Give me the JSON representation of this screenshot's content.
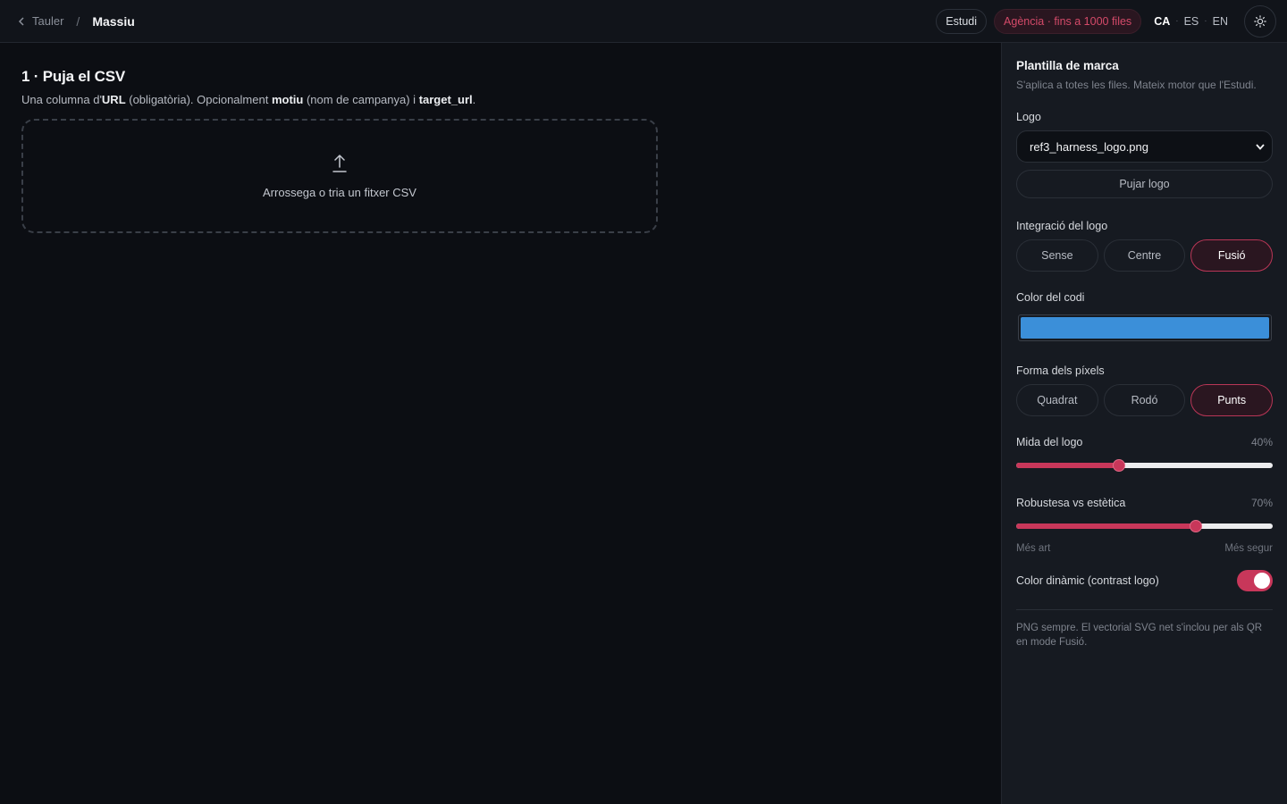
{
  "breadcrumb": {
    "back_label": "Tauler",
    "separator": "/",
    "current": "Massiu"
  },
  "topbar": {
    "studio_label": "Estudi",
    "agency_label": "Agència · fins a 1000 files",
    "languages": [
      {
        "code": "CA",
        "active": true
      },
      {
        "code": "ES",
        "active": false
      },
      {
        "code": "EN",
        "active": false
      }
    ],
    "lang_separator": "·",
    "theme_icon": "sun-icon"
  },
  "main": {
    "step_title": "1 · Puja el CSV",
    "desc_1": "Una columna d'",
    "desc_url": "URL",
    "desc_2": " (obligatòria). Opcionalment ",
    "desc_motiu": "motiu",
    "desc_3": " (nom de campanya) i ",
    "desc_target": "target_url",
    "desc_4": ".",
    "dropzone_icon": "upload-icon",
    "dropzone_text": "Arrossega o tria un fitxer CSV"
  },
  "panel": {
    "title": "Plantilla de marca",
    "subtitle": "S'aplica a totes les files. Mateix motor que l'Estudi.",
    "logo_label": "Logo",
    "logo_select_value": "ref3_harness_logo.png",
    "upload_logo_label": "Pujar logo",
    "integration_label": "Integració del logo",
    "integration_options": [
      "Sense",
      "Centre",
      "Fusió"
    ],
    "integration_selected": "Fusió",
    "code_color_label": "Color del codi",
    "code_color": "#3b8fd9",
    "pixel_shape_label": "Forma dels píxels",
    "pixel_shape_options": [
      "Quadrat",
      "Rodó",
      "Punts"
    ],
    "pixel_shape_selected": "Punts",
    "logo_size_label": "Mida del logo",
    "logo_size_value": "40%",
    "logo_size_fraction": 0.4,
    "robustness_label": "Robustesa vs estètica",
    "robustness_value": "70%",
    "robustness_fraction": 0.7,
    "robustness_min_label": "Més art",
    "robustness_max_label": "Més segur",
    "dynamic_color_label": "Color dinàmic (contrast logo)",
    "dynamic_color_on": true,
    "note": "PNG sempre. El vectorial SVG net s'inclou per als QR en mode Fusió."
  },
  "colors": {
    "accent": "#c8375a",
    "background": "#0c0e13",
    "panel": "#161a21"
  }
}
